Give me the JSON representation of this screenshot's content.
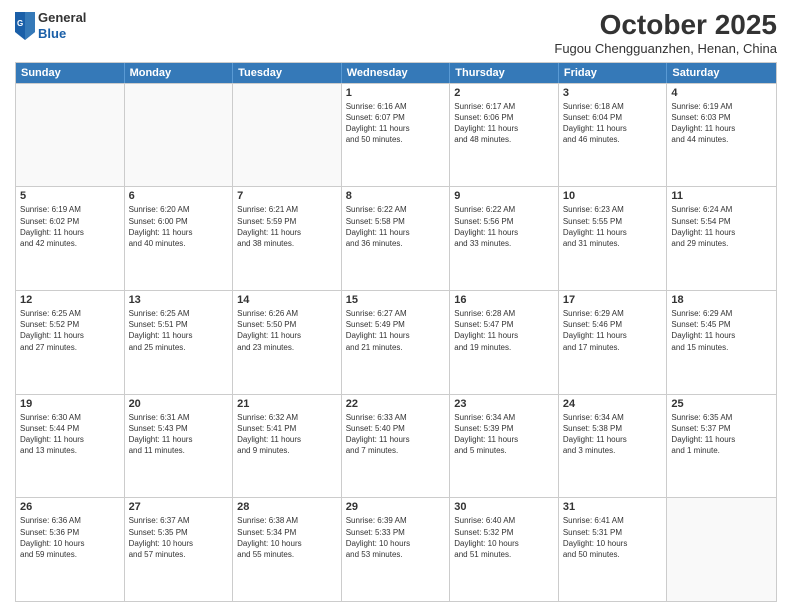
{
  "header": {
    "logo": {
      "general": "General",
      "blue": "Blue"
    },
    "title": "October 2025",
    "location": "Fugou Chengguanzhen, Henan, China"
  },
  "days_of_week": [
    "Sunday",
    "Monday",
    "Tuesday",
    "Wednesday",
    "Thursday",
    "Friday",
    "Saturday"
  ],
  "weeks": [
    [
      {
        "day": "",
        "info": ""
      },
      {
        "day": "",
        "info": ""
      },
      {
        "day": "",
        "info": ""
      },
      {
        "day": "1",
        "info": "Sunrise: 6:16 AM\nSunset: 6:07 PM\nDaylight: 11 hours\nand 50 minutes."
      },
      {
        "day": "2",
        "info": "Sunrise: 6:17 AM\nSunset: 6:06 PM\nDaylight: 11 hours\nand 48 minutes."
      },
      {
        "day": "3",
        "info": "Sunrise: 6:18 AM\nSunset: 6:04 PM\nDaylight: 11 hours\nand 46 minutes."
      },
      {
        "day": "4",
        "info": "Sunrise: 6:19 AM\nSunset: 6:03 PM\nDaylight: 11 hours\nand 44 minutes."
      }
    ],
    [
      {
        "day": "5",
        "info": "Sunrise: 6:19 AM\nSunset: 6:02 PM\nDaylight: 11 hours\nand 42 minutes."
      },
      {
        "day": "6",
        "info": "Sunrise: 6:20 AM\nSunset: 6:00 PM\nDaylight: 11 hours\nand 40 minutes."
      },
      {
        "day": "7",
        "info": "Sunrise: 6:21 AM\nSunset: 5:59 PM\nDaylight: 11 hours\nand 38 minutes."
      },
      {
        "day": "8",
        "info": "Sunrise: 6:22 AM\nSunset: 5:58 PM\nDaylight: 11 hours\nand 36 minutes."
      },
      {
        "day": "9",
        "info": "Sunrise: 6:22 AM\nSunset: 5:56 PM\nDaylight: 11 hours\nand 33 minutes."
      },
      {
        "day": "10",
        "info": "Sunrise: 6:23 AM\nSunset: 5:55 PM\nDaylight: 11 hours\nand 31 minutes."
      },
      {
        "day": "11",
        "info": "Sunrise: 6:24 AM\nSunset: 5:54 PM\nDaylight: 11 hours\nand 29 minutes."
      }
    ],
    [
      {
        "day": "12",
        "info": "Sunrise: 6:25 AM\nSunset: 5:52 PM\nDaylight: 11 hours\nand 27 minutes."
      },
      {
        "day": "13",
        "info": "Sunrise: 6:25 AM\nSunset: 5:51 PM\nDaylight: 11 hours\nand 25 minutes."
      },
      {
        "day": "14",
        "info": "Sunrise: 6:26 AM\nSunset: 5:50 PM\nDaylight: 11 hours\nand 23 minutes."
      },
      {
        "day": "15",
        "info": "Sunrise: 6:27 AM\nSunset: 5:49 PM\nDaylight: 11 hours\nand 21 minutes."
      },
      {
        "day": "16",
        "info": "Sunrise: 6:28 AM\nSunset: 5:47 PM\nDaylight: 11 hours\nand 19 minutes."
      },
      {
        "day": "17",
        "info": "Sunrise: 6:29 AM\nSunset: 5:46 PM\nDaylight: 11 hours\nand 17 minutes."
      },
      {
        "day": "18",
        "info": "Sunrise: 6:29 AM\nSunset: 5:45 PM\nDaylight: 11 hours\nand 15 minutes."
      }
    ],
    [
      {
        "day": "19",
        "info": "Sunrise: 6:30 AM\nSunset: 5:44 PM\nDaylight: 11 hours\nand 13 minutes."
      },
      {
        "day": "20",
        "info": "Sunrise: 6:31 AM\nSunset: 5:43 PM\nDaylight: 11 hours\nand 11 minutes."
      },
      {
        "day": "21",
        "info": "Sunrise: 6:32 AM\nSunset: 5:41 PM\nDaylight: 11 hours\nand 9 minutes."
      },
      {
        "day": "22",
        "info": "Sunrise: 6:33 AM\nSunset: 5:40 PM\nDaylight: 11 hours\nand 7 minutes."
      },
      {
        "day": "23",
        "info": "Sunrise: 6:34 AM\nSunset: 5:39 PM\nDaylight: 11 hours\nand 5 minutes."
      },
      {
        "day": "24",
        "info": "Sunrise: 6:34 AM\nSunset: 5:38 PM\nDaylight: 11 hours\nand 3 minutes."
      },
      {
        "day": "25",
        "info": "Sunrise: 6:35 AM\nSunset: 5:37 PM\nDaylight: 11 hours\nand 1 minute."
      }
    ],
    [
      {
        "day": "26",
        "info": "Sunrise: 6:36 AM\nSunset: 5:36 PM\nDaylight: 10 hours\nand 59 minutes."
      },
      {
        "day": "27",
        "info": "Sunrise: 6:37 AM\nSunset: 5:35 PM\nDaylight: 10 hours\nand 57 minutes."
      },
      {
        "day": "28",
        "info": "Sunrise: 6:38 AM\nSunset: 5:34 PM\nDaylight: 10 hours\nand 55 minutes."
      },
      {
        "day": "29",
        "info": "Sunrise: 6:39 AM\nSunset: 5:33 PM\nDaylight: 10 hours\nand 53 minutes."
      },
      {
        "day": "30",
        "info": "Sunrise: 6:40 AM\nSunset: 5:32 PM\nDaylight: 10 hours\nand 51 minutes."
      },
      {
        "day": "31",
        "info": "Sunrise: 6:41 AM\nSunset: 5:31 PM\nDaylight: 10 hours\nand 50 minutes."
      },
      {
        "day": "",
        "info": ""
      }
    ]
  ]
}
